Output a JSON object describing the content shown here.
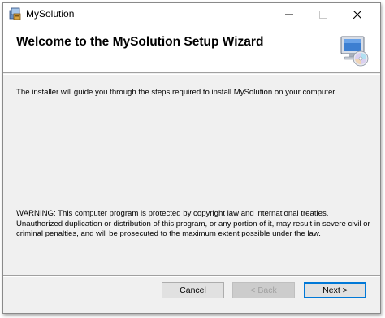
{
  "window": {
    "title": "MySolution",
    "controls": {
      "minimize": "–",
      "maximize": "☐",
      "close": "✕"
    }
  },
  "banner": {
    "title": "Welcome to the MySolution Setup Wizard",
    "icon": "computer-cd-icon"
  },
  "content": {
    "intro": "The installer will guide you through the steps required to install MySolution on your computer.",
    "warning": "WARNING: This computer program is protected by copyright law and international treaties. Unauthorized duplication or distribution of this program, or any portion of it, may result in severe civil or criminal penalties, and will be prosecuted to the maximum extent possible under the law."
  },
  "buttons": {
    "cancel": "Cancel",
    "back": "< Back",
    "next": "Next >"
  },
  "colors": {
    "accent": "#0078d7",
    "window_bg": "#f0f0f0",
    "banner_bg": "#ffffff"
  }
}
